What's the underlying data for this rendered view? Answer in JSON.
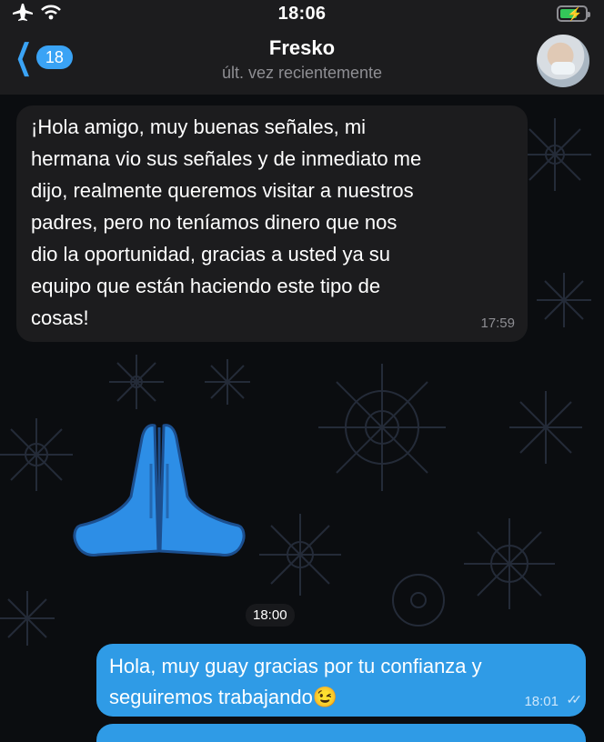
{
  "status_bar": {
    "time": "18:06"
  },
  "header": {
    "back_count": "18",
    "title": "Fresko",
    "subtitle": "últ. vez recientemente"
  },
  "messages": [
    {
      "direction": "in",
      "text": "¡Hola amigo, muy buenas señales, mi\nhermana vio sus señales y de inmediato me\ndijo, realmente queremos visitar a nuestros\npadres, pero no teníamos dinero que nos\ndio la oportunidad, gracias a usted ya su\nequipo que están haciendo este tipo de\ncosas!",
      "time": "17:59"
    },
    {
      "direction": "in",
      "type": "sticker",
      "sticker": "folded-hands-icon",
      "time": "18:00"
    },
    {
      "direction": "out",
      "text": "Hola, muy guay gracias por tu confianza y\nseguiremos trabajando😉",
      "time": "18:01",
      "status": "read"
    }
  ],
  "colors": {
    "accent": "#3aa3f5",
    "outgoing_bubble": "#2f9be6",
    "incoming_bubble": "#1c1c1e",
    "background": "#0b0d10"
  }
}
